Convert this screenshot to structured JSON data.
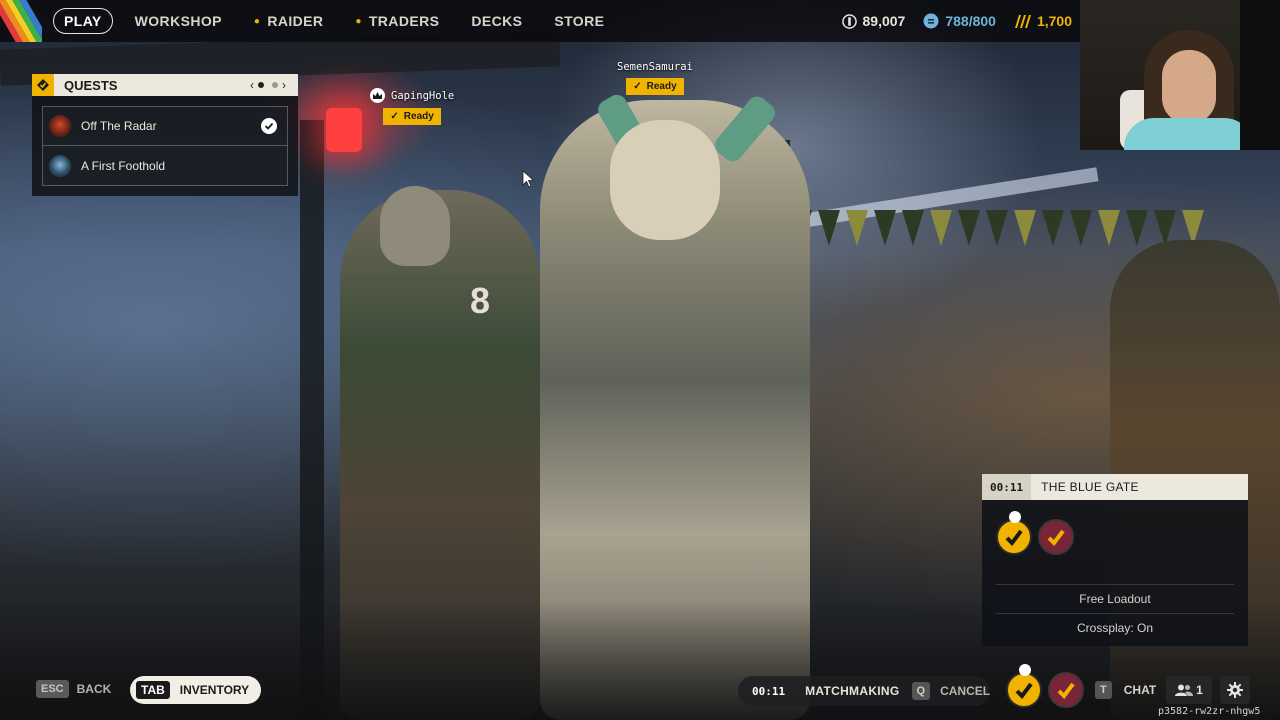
{
  "nav": {
    "play": "PLAY",
    "items": [
      {
        "label": "WORKSHOP",
        "dot": false
      },
      {
        "label": "RAIDER",
        "dot": true
      },
      {
        "label": "TRADERS",
        "dot": true
      },
      {
        "label": "DECKS",
        "dot": false
      },
      {
        "label": "STORE",
        "dot": false
      }
    ]
  },
  "currencies": {
    "coins": "89,007",
    "creds": "788/800",
    "raider_tokens": "1,700"
  },
  "quests": {
    "title": "QUESTS",
    "items": [
      {
        "label": "Off The Radar",
        "completed": true
      },
      {
        "label": "A First Foothold",
        "completed": false
      }
    ]
  },
  "players": [
    {
      "name": "GapingHole",
      "status": "Ready",
      "leader": true
    },
    {
      "name": "SemenSamurai",
      "status": "Ready",
      "leader": false
    }
  ],
  "lobby": {
    "timer": "00:11",
    "map": "THE BLUE GATE",
    "loadout": "Free Loadout",
    "crossplay": "Crossplay: On"
  },
  "bottom": {
    "back_key": "ESC",
    "back_label": "BACK",
    "inventory_key": "TAB",
    "inventory_label": "INVENTORY",
    "mm_timer": "00:11",
    "mm_label": "MATCHMAKING",
    "cancel_key": "Q",
    "cancel_label": "CANCEL",
    "chat_key": "T",
    "chat_label": "CHAT",
    "friends_count": "1",
    "session_id": "p3582-rw2zr-nhgw5"
  },
  "colors": {
    "accent": "#f0b400",
    "panel_light": "#ece8de",
    "creds": "#6fb3dc"
  },
  "icons": [
    "crown-icon",
    "check-icon",
    "coin-icon",
    "creds-icon",
    "raider-token-icon",
    "gear-icon",
    "friends-icon",
    "quest-icon"
  ]
}
